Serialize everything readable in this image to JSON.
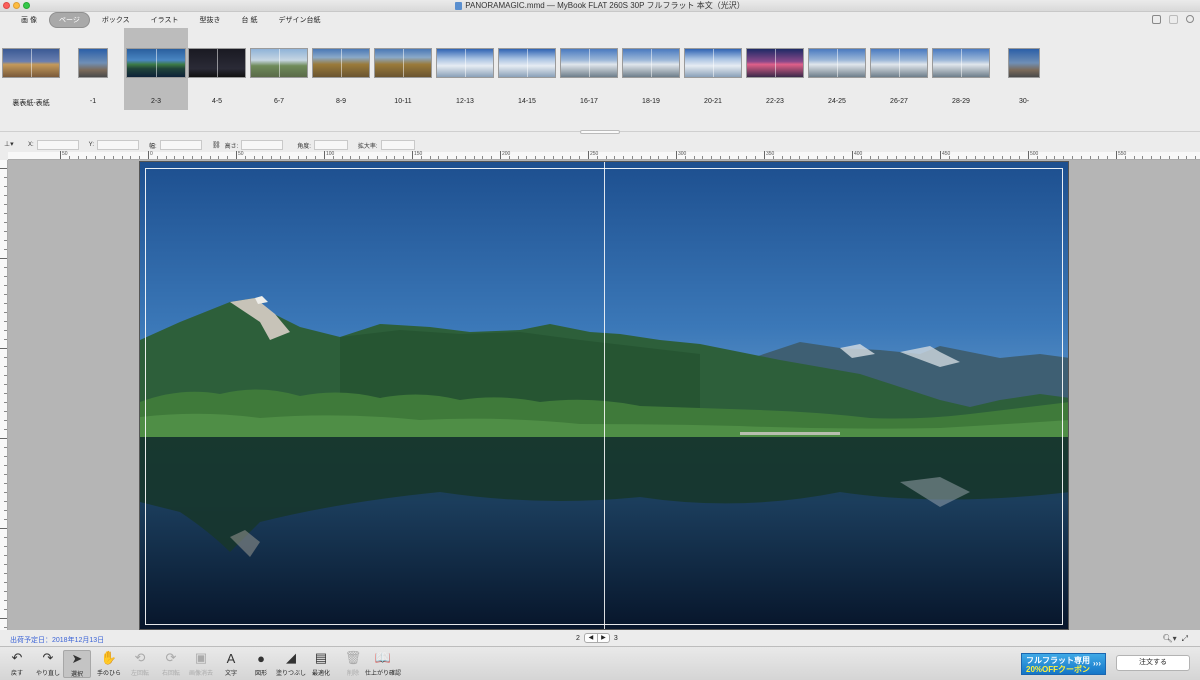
{
  "window": {
    "title": "PANORAMAGIC.mmd — MyBook FLAT 260S 30P フルフラット 本文（光沢）"
  },
  "tabs": [
    {
      "label": "画 像",
      "active": false
    },
    {
      "label": "ページ",
      "active": true
    },
    {
      "label": "ボックス",
      "active": false
    },
    {
      "label": "イラスト",
      "active": false
    },
    {
      "label": "型抜き",
      "active": false
    },
    {
      "label": "台 紙",
      "active": false
    },
    {
      "label": "デザイン台紙",
      "active": false
    }
  ],
  "thumbnails": [
    {
      "label": "裏表紙-表紙",
      "theme": "sunset-rock",
      "selected": false
    },
    {
      "label": "-1",
      "theme": "peak-blue",
      "selected": false
    },
    {
      "label": "2-3",
      "theme": "lake",
      "selected": true
    },
    {
      "label": "4-5",
      "theme": "night",
      "selected": false
    },
    {
      "label": "6-7",
      "theme": "ridge-trail",
      "selected": false
    },
    {
      "label": "8-9",
      "theme": "autumn",
      "selected": false
    },
    {
      "label": "10-11",
      "theme": "autumn",
      "selected": false
    },
    {
      "label": "12-13",
      "theme": "snow-cloud",
      "selected": false
    },
    {
      "label": "14-15",
      "theme": "snow-cloud",
      "selected": false
    },
    {
      "label": "16-17",
      "theme": "snow-ridge",
      "selected": false
    },
    {
      "label": "18-19",
      "theme": "snow-ridge",
      "selected": false
    },
    {
      "label": "20-21",
      "theme": "snow-cloud",
      "selected": false
    },
    {
      "label": "22-23",
      "theme": "dusk",
      "selected": false
    },
    {
      "label": "24-25",
      "theme": "snow-ridge",
      "selected": false
    },
    {
      "label": "26-27",
      "theme": "snow-ridge",
      "selected": false
    },
    {
      "label": "28-29",
      "theme": "snow-ridge",
      "selected": false
    },
    {
      "label": "30-",
      "theme": "peak-blue",
      "selected": false
    }
  ],
  "coords": {
    "x_label": "X:",
    "y_label": "Y:",
    "width_label": "幅:",
    "height_label": "高さ:",
    "angle_label": "角度:",
    "scale_label": "拡大率:"
  },
  "ruler": {
    "labels": [
      "50",
      "0",
      "50",
      "100",
      "150",
      "200",
      "250",
      "300",
      "350",
      "400",
      "450",
      "500",
      "550"
    ]
  },
  "status": {
    "ship_date": "出荷予定日：2018年12月13日",
    "page_left": "2",
    "page_right": "3"
  },
  "tools": [
    {
      "label": "戻す",
      "icon": "undo-icon",
      "glyph": "↶",
      "disabled": false,
      "selected": false
    },
    {
      "label": "やり直し",
      "icon": "redo-icon",
      "glyph": "↷",
      "disabled": false,
      "selected": false
    },
    {
      "label": "選択",
      "icon": "arrow-cursor-icon",
      "glyph": "➤",
      "disabled": false,
      "selected": true
    },
    {
      "label": "手のひら",
      "icon": "hand-icon",
      "glyph": "✋",
      "disabled": false,
      "selected": false
    },
    {
      "label": "左回転",
      "icon": "rotate-left-icon",
      "glyph": "⟲",
      "disabled": true,
      "selected": false
    },
    {
      "label": "右回転",
      "icon": "rotate-right-icon",
      "glyph": "⟳",
      "disabled": true,
      "selected": false
    },
    {
      "label": "画像消去",
      "icon": "image-delete-icon",
      "glyph": "▣",
      "disabled": true,
      "selected": false
    },
    {
      "label": "文字",
      "icon": "text-icon",
      "glyph": "A",
      "disabled": false,
      "selected": false
    },
    {
      "label": "図形",
      "icon": "shape-icon",
      "glyph": "●",
      "disabled": false,
      "selected": false
    },
    {
      "label": "塗りつぶし",
      "icon": "paint-bucket-icon",
      "glyph": "◢",
      "disabled": false,
      "selected": false
    },
    {
      "label": "最適化",
      "icon": "optimize-icon",
      "glyph": "▤",
      "disabled": false,
      "selected": false
    },
    {
      "label": "削除",
      "icon": "trash-icon",
      "glyph": "🗑",
      "disabled": true,
      "selected": false
    },
    {
      "label": "仕上がり確認",
      "icon": "book-preview-icon",
      "glyph": "📖",
      "disabled": false,
      "selected": false
    }
  ],
  "coupon": {
    "line1": "フルフラット専用",
    "line2": "20%OFFクーポン",
    "arrows": "›››"
  },
  "order_button": "注文する",
  "colors": {
    "accent_blue": "#3b63d6",
    "coupon_blue": "#1576c8",
    "selected_gray": "#bcbcbc"
  }
}
